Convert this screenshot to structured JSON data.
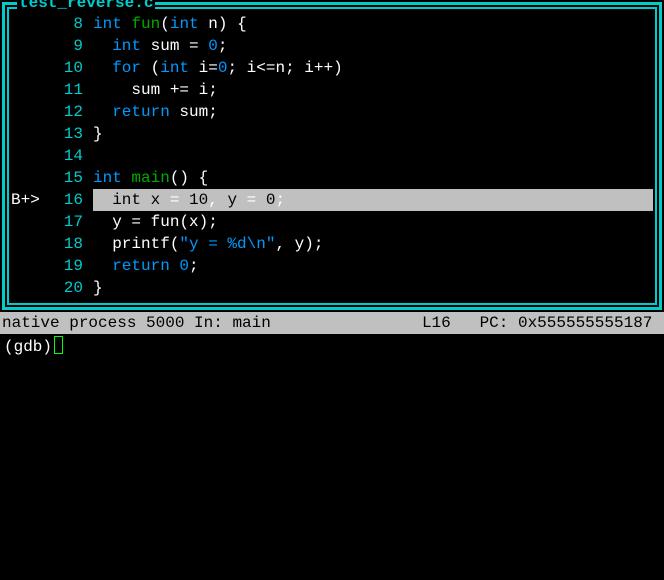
{
  "window": {
    "title": "test_reverse.c"
  },
  "code": {
    "lines": [
      {
        "num": "8",
        "marker": "",
        "highlighted": false,
        "tokens": [
          [
            "kw",
            "int"
          ],
          [
            "punct",
            " "
          ],
          [
            "fn",
            "fun"
          ],
          [
            "punct",
            "("
          ],
          [
            "kw",
            "int"
          ],
          [
            "punct",
            " "
          ],
          [
            "id",
            "n"
          ],
          [
            "punct",
            ") {"
          ]
        ]
      },
      {
        "num": "9",
        "marker": "",
        "highlighted": false,
        "tokens": [
          [
            "punct",
            "  "
          ],
          [
            "kw",
            "int"
          ],
          [
            "punct",
            " "
          ],
          [
            "id",
            "sum"
          ],
          [
            "punct",
            " = "
          ],
          [
            "num",
            "0"
          ],
          [
            "punct",
            ";"
          ]
        ]
      },
      {
        "num": "10",
        "marker": "",
        "highlighted": false,
        "tokens": [
          [
            "punct",
            "  "
          ],
          [
            "kw",
            "for"
          ],
          [
            "punct",
            " ("
          ],
          [
            "kw",
            "int"
          ],
          [
            "punct",
            " "
          ],
          [
            "id",
            "i"
          ],
          [
            "punct",
            "="
          ],
          [
            "num",
            "0"
          ],
          [
            "punct",
            "; "
          ],
          [
            "id",
            "i"
          ],
          [
            "punct",
            "<="
          ],
          [
            "id",
            "n"
          ],
          [
            "punct",
            "; "
          ],
          [
            "id",
            "i"
          ],
          [
            "punct",
            "++)"
          ]
        ]
      },
      {
        "num": "11",
        "marker": "",
        "highlighted": false,
        "tokens": [
          [
            "punct",
            "    "
          ],
          [
            "id",
            "sum"
          ],
          [
            "punct",
            " += "
          ],
          [
            "id",
            "i"
          ],
          [
            "punct",
            ";"
          ]
        ]
      },
      {
        "num": "12",
        "marker": "",
        "highlighted": false,
        "tokens": [
          [
            "punct",
            "  "
          ],
          [
            "kw",
            "return"
          ],
          [
            "punct",
            " "
          ],
          [
            "id",
            "sum"
          ],
          [
            "punct",
            ";"
          ]
        ]
      },
      {
        "num": "13",
        "marker": "",
        "highlighted": false,
        "tokens": [
          [
            "punct",
            "}"
          ]
        ]
      },
      {
        "num": "14",
        "marker": "",
        "highlighted": false,
        "tokens": []
      },
      {
        "num": "15",
        "marker": "",
        "highlighted": false,
        "tokens": [
          [
            "kw",
            "int"
          ],
          [
            "punct",
            " "
          ],
          [
            "fn",
            "main"
          ],
          [
            "punct",
            "() {"
          ]
        ]
      },
      {
        "num": "16",
        "marker": "B+>",
        "highlighted": true,
        "tokens": [
          [
            "punct",
            "  "
          ],
          [
            "kw",
            "int"
          ],
          [
            "punct",
            " "
          ],
          [
            "id",
            "x"
          ],
          [
            "punct",
            " = "
          ],
          [
            "num",
            "10"
          ],
          [
            "punct",
            ", "
          ],
          [
            "id",
            "y"
          ],
          [
            "punct",
            " = "
          ],
          [
            "num",
            "0"
          ],
          [
            "punct",
            ";"
          ]
        ]
      },
      {
        "num": "17",
        "marker": "",
        "highlighted": false,
        "tokens": [
          [
            "punct",
            "  "
          ],
          [
            "id",
            "y"
          ],
          [
            "punct",
            " = "
          ],
          [
            "id",
            "fun"
          ],
          [
            "punct",
            "("
          ],
          [
            "id",
            "x"
          ],
          [
            "punct",
            ");"
          ]
        ]
      },
      {
        "num": "18",
        "marker": "",
        "highlighted": false,
        "tokens": [
          [
            "punct",
            "  "
          ],
          [
            "id",
            "printf"
          ],
          [
            "punct",
            "("
          ],
          [
            "str",
            "\"y = %d\\n\""
          ],
          [
            "punct",
            ", "
          ],
          [
            "id",
            "y"
          ],
          [
            "punct",
            ");"
          ]
        ]
      },
      {
        "num": "19",
        "marker": "",
        "highlighted": false,
        "tokens": [
          [
            "punct",
            "  "
          ],
          [
            "kw",
            "return"
          ],
          [
            "punct",
            " "
          ],
          [
            "num",
            "0"
          ],
          [
            "punct",
            ";"
          ]
        ]
      },
      {
        "num": "20",
        "marker": "",
        "highlighted": false,
        "tokens": [
          [
            "punct",
            "}"
          ]
        ]
      }
    ]
  },
  "status": {
    "left": "native process 5000 In: main",
    "right": "L16   PC: 0x555555555187 "
  },
  "prompt": {
    "text": "(gdb) "
  }
}
